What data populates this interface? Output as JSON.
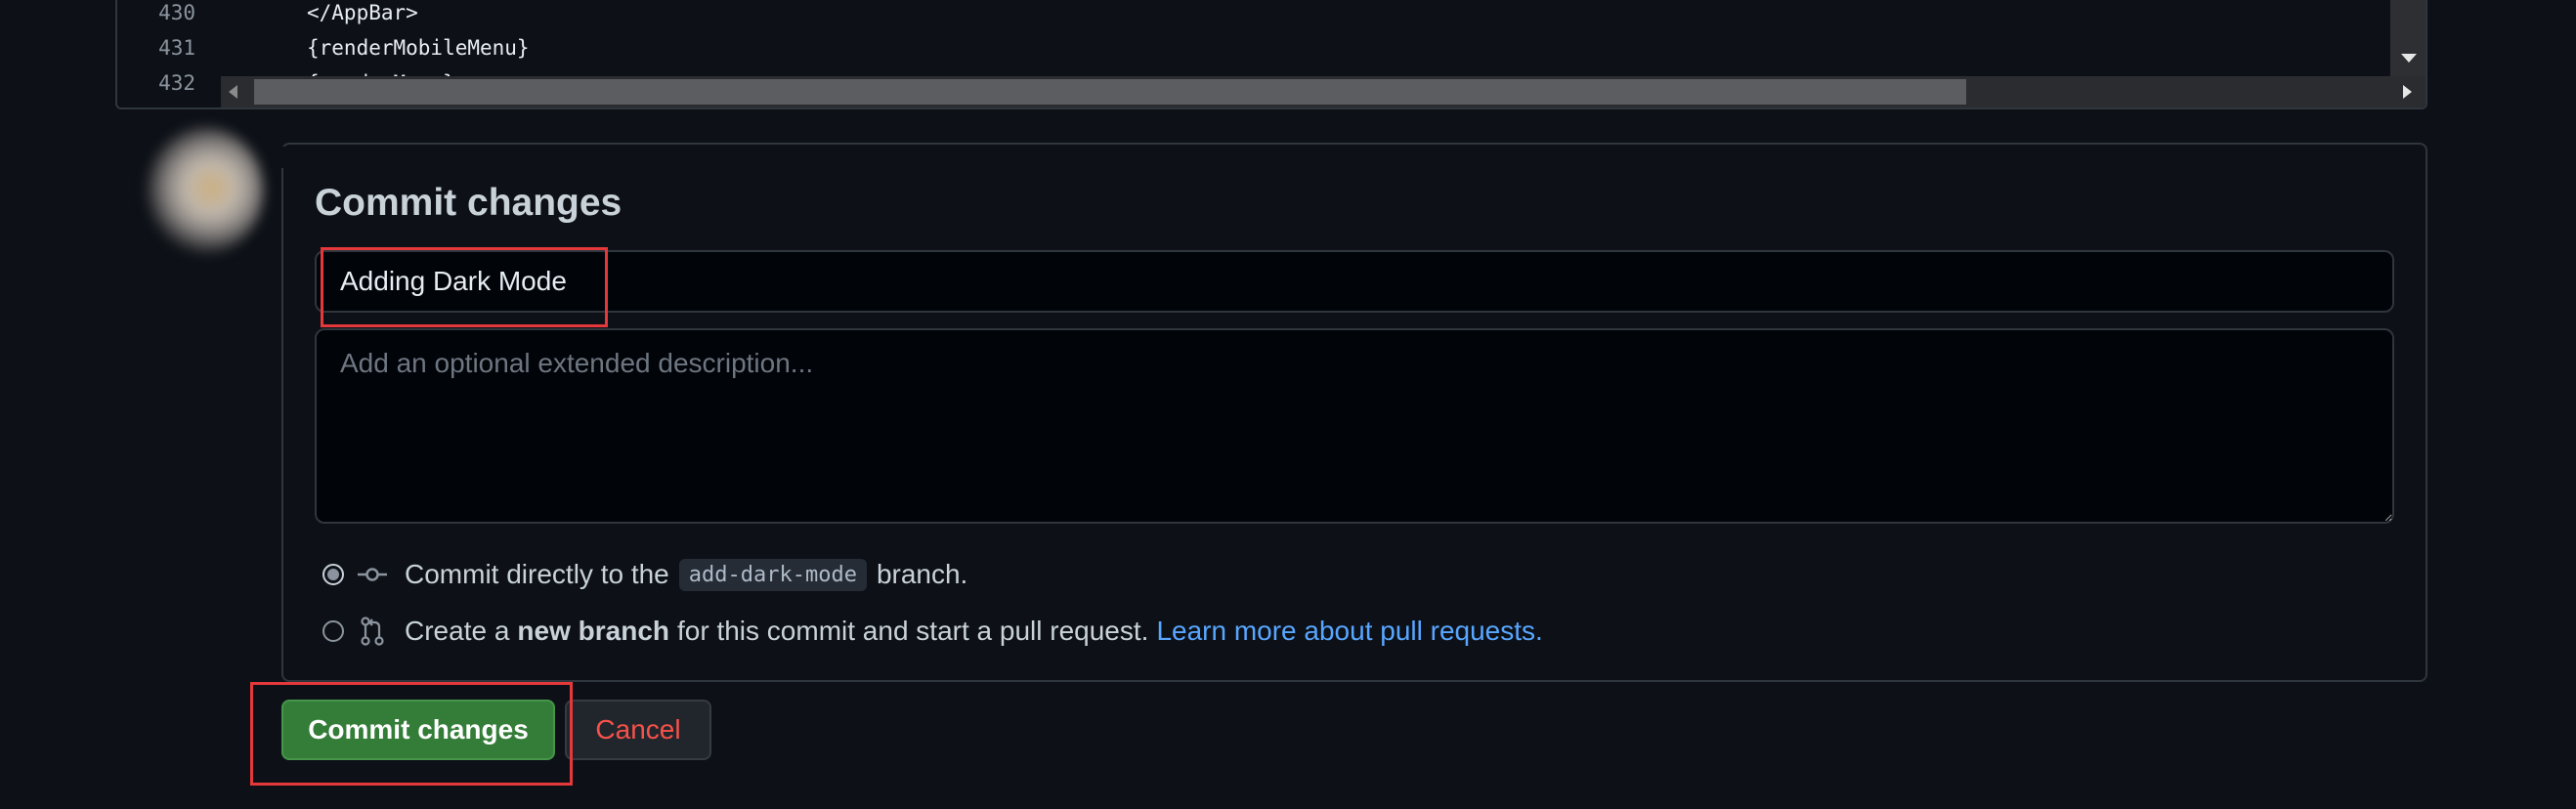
{
  "editor": {
    "lines": [
      {
        "num": "430",
        "code": "</AppBar>"
      },
      {
        "num": "431",
        "code": "{renderMobileMenu}"
      },
      {
        "num": "432",
        "code": "{renderMenu}"
      }
    ]
  },
  "commit": {
    "title": "Commit changes",
    "summary_value": "Adding Dark Mode",
    "description_placeholder": "Add an optional extended description...",
    "option_direct": {
      "prefix": "Commit directly to the",
      "branch": "add-dark-mode",
      "suffix": "branch.",
      "selected": true
    },
    "option_new_branch": {
      "prefix": "Create a",
      "bold": "new branch",
      "suffix": "for this commit and start a pull request.",
      "link": "Learn more about pull requests.",
      "selected": false
    }
  },
  "buttons": {
    "commit_label": "Commit changes",
    "cancel_label": "Cancel"
  },
  "colors": {
    "background": "#0d1117",
    "primary_button": "#347d39",
    "cancel_text": "#f85149",
    "link": "#58a6ff",
    "highlight": "#e5383b"
  },
  "icons": [
    "git-commit-icon",
    "git-pull-request-icon",
    "avatar"
  ]
}
